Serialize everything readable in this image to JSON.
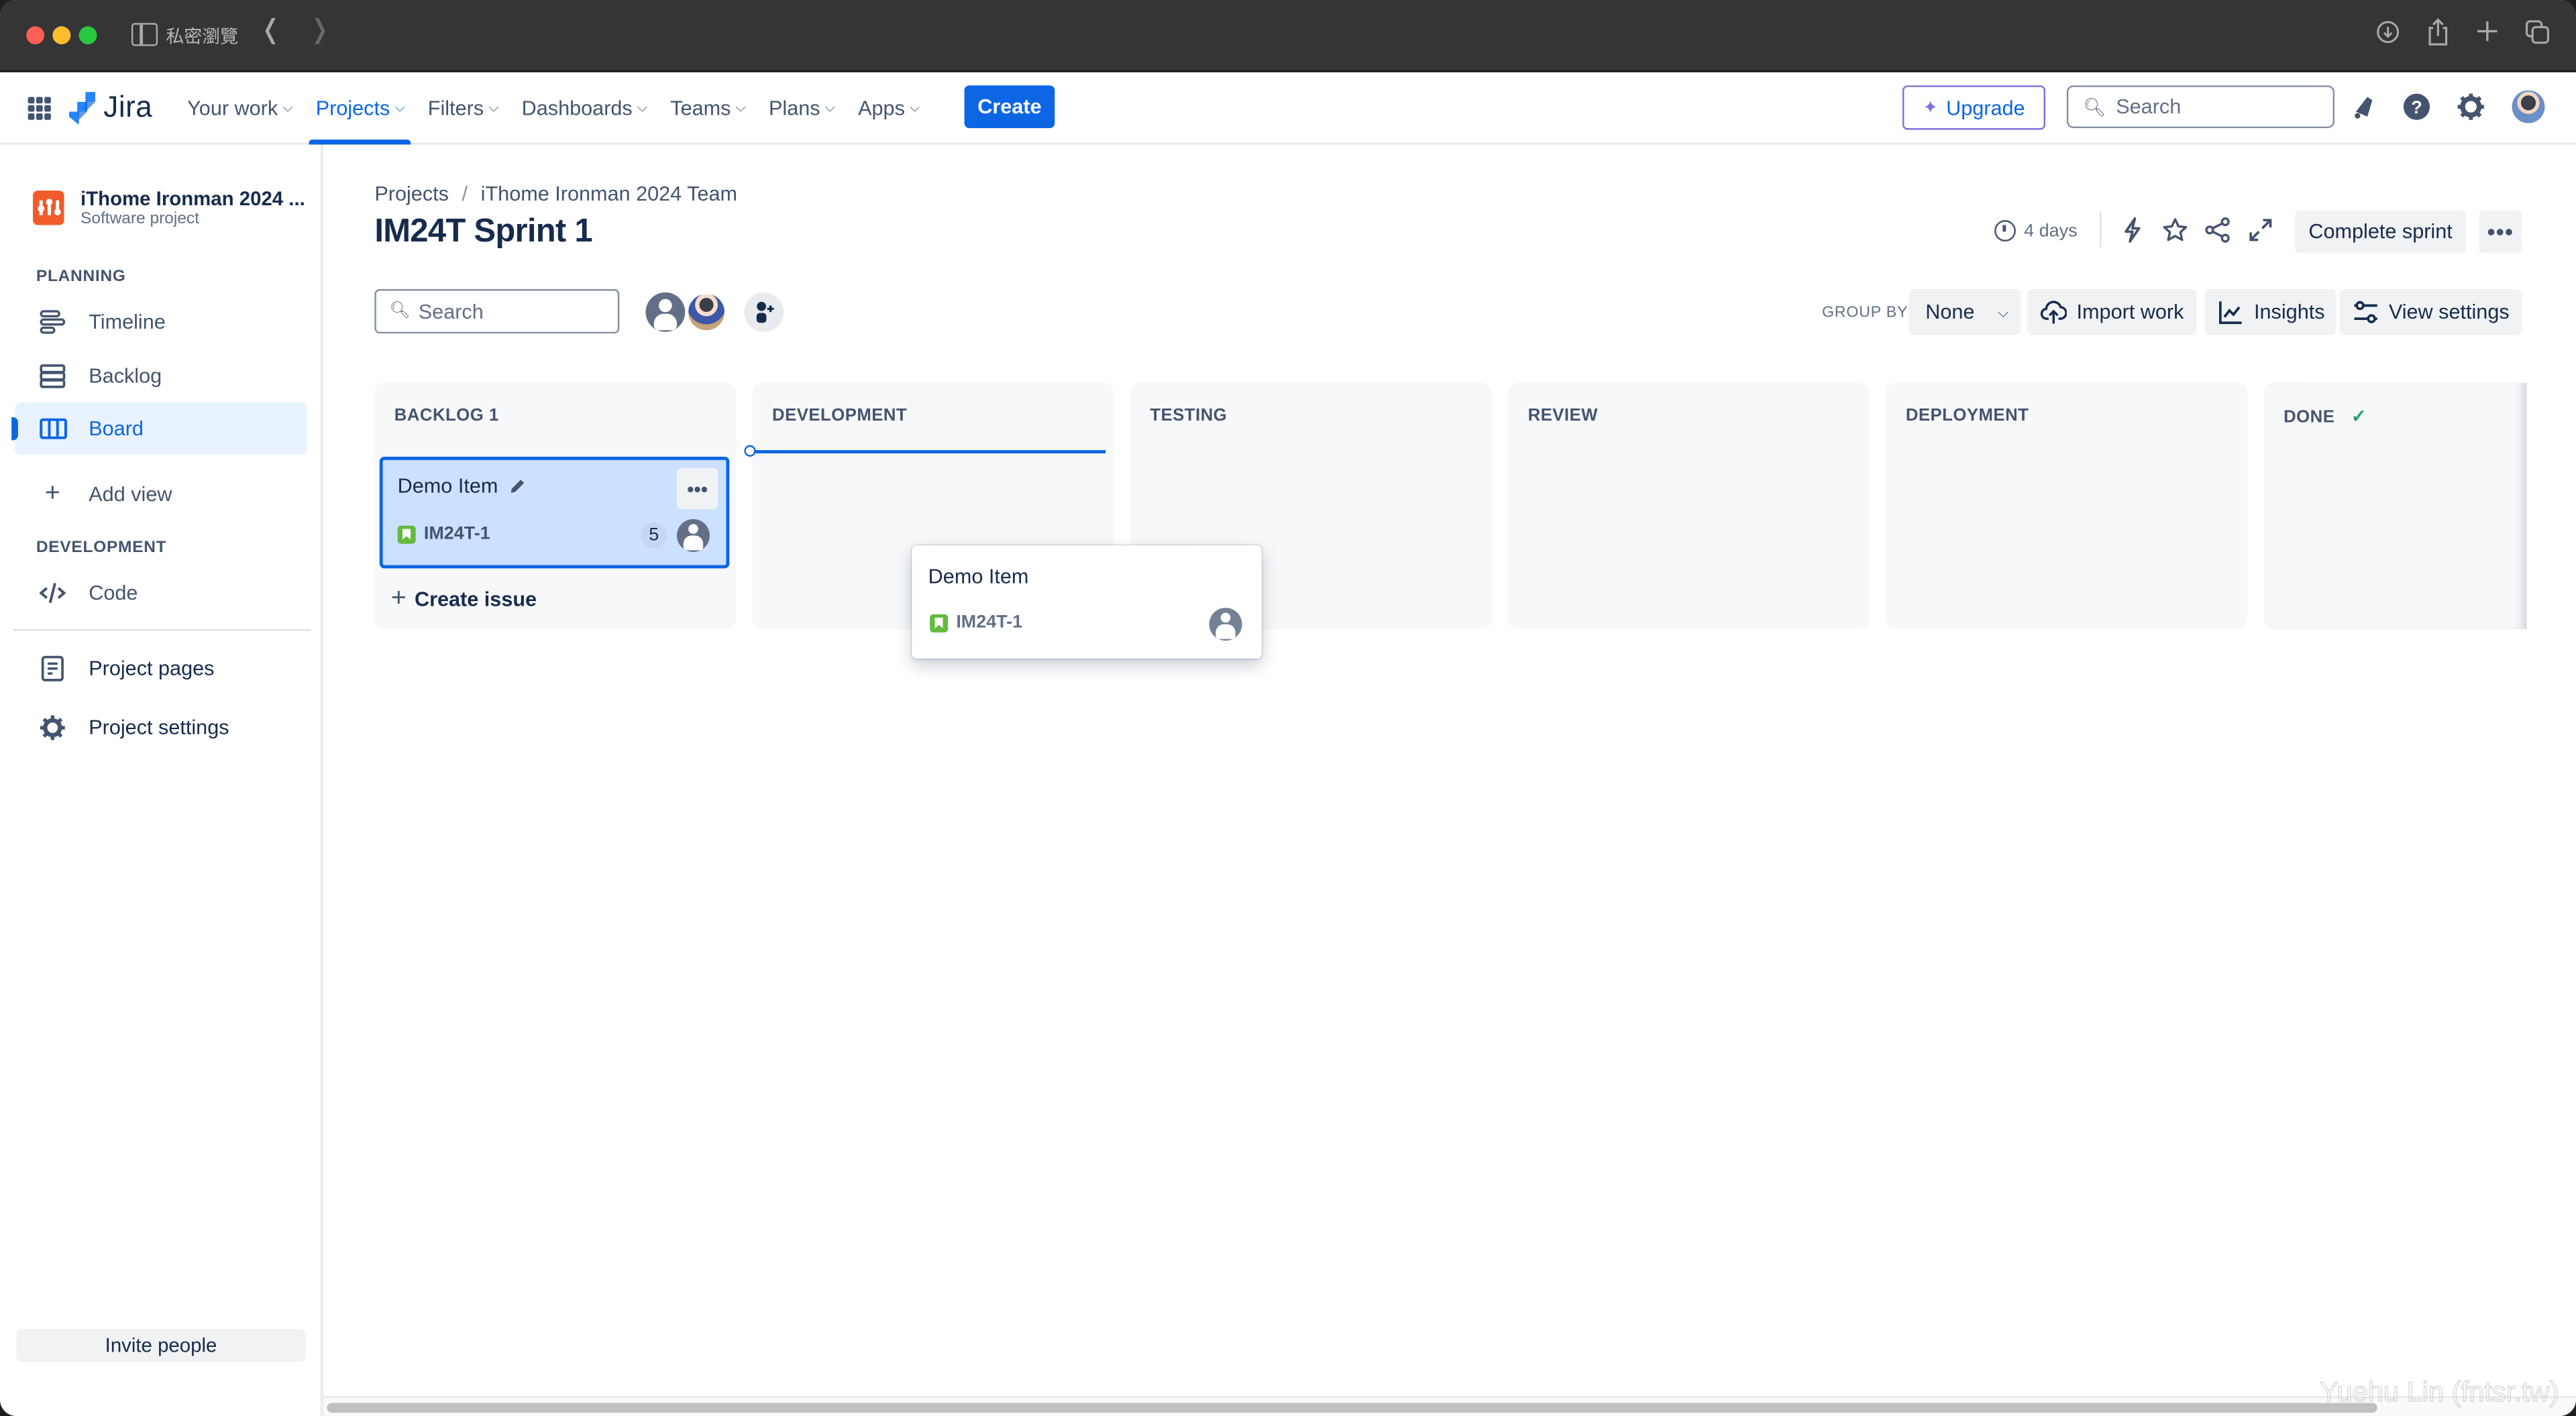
{
  "browser": {
    "mode_label": "私密瀏覽",
    "icons": [
      "sidebar-toggle-icon",
      "back-icon",
      "forward-icon",
      "download-icon",
      "share-icon",
      "new-tab-icon",
      "tabs-overview-icon"
    ]
  },
  "topnav": {
    "logo_text": "Jira",
    "items": [
      {
        "label": "Your work",
        "active": false
      },
      {
        "label": "Projects",
        "active": true
      },
      {
        "label": "Filters",
        "active": false
      },
      {
        "label": "Dashboards",
        "active": false
      },
      {
        "label": "Teams",
        "active": false
      },
      {
        "label": "Plans",
        "active": false
      },
      {
        "label": "Apps",
        "active": false
      }
    ],
    "create_label": "Create",
    "upgrade_label": "Upgrade",
    "search_placeholder": "Search",
    "accent_color": "#0c66e4"
  },
  "sidebar": {
    "project_name": "iThome Ironman 2024 ...",
    "project_type": "Software project",
    "planning_label": "PLANNING",
    "planning_items": [
      {
        "label": "Timeline",
        "icon": "timeline-icon"
      },
      {
        "label": "Backlog",
        "icon": "backlog-icon"
      },
      {
        "label": "Board",
        "icon": "board-icon",
        "active": true
      }
    ],
    "add_view_label": "Add view",
    "development_label": "DEVELOPMENT",
    "development_items": [
      {
        "label": "Code",
        "icon": "code-icon"
      }
    ],
    "bottom_items": [
      {
        "label": "Project pages",
        "icon": "pages-icon"
      },
      {
        "label": "Project settings",
        "icon": "settings-icon"
      }
    ],
    "invite_label": "Invite people"
  },
  "header": {
    "breadcrumb": [
      "Projects",
      "iThome Ironman 2024 Team"
    ],
    "breadcrumb_sep": "/",
    "title": "IM24T Sprint 1",
    "time_remaining": "4 days",
    "complete_sprint_label": "Complete sprint",
    "more_label": "•••"
  },
  "toolbar": {
    "search_placeholder": "Search",
    "group_by_label": "GROUP BY",
    "group_by_value": "None",
    "import_label": "Import work",
    "insights_label": "Insights",
    "view_settings_label": "View settings"
  },
  "board": {
    "columns": [
      {
        "title": "BACKLOG 1"
      },
      {
        "title": "DEVELOPMENT"
      },
      {
        "title": "TESTING"
      },
      {
        "title": "REVIEW"
      },
      {
        "title": "DEPLOYMENT"
      },
      {
        "title": "DONE",
        "done": true
      }
    ],
    "done_check": "✓",
    "cards": [
      {
        "title": "Demo Item",
        "key": "IM24T-1",
        "type": "story",
        "story_points": "5",
        "column": "BACKLOG 1",
        "selected": true
      }
    ],
    "create_issue_label": "Create issue",
    "dragging_card": {
      "title": "Demo Item",
      "key": "IM24T-1"
    },
    "story_color": "#63ba3c",
    "done_color": "#22a06b"
  },
  "watermark": "Yuehu Lin (fntsr.tw)"
}
